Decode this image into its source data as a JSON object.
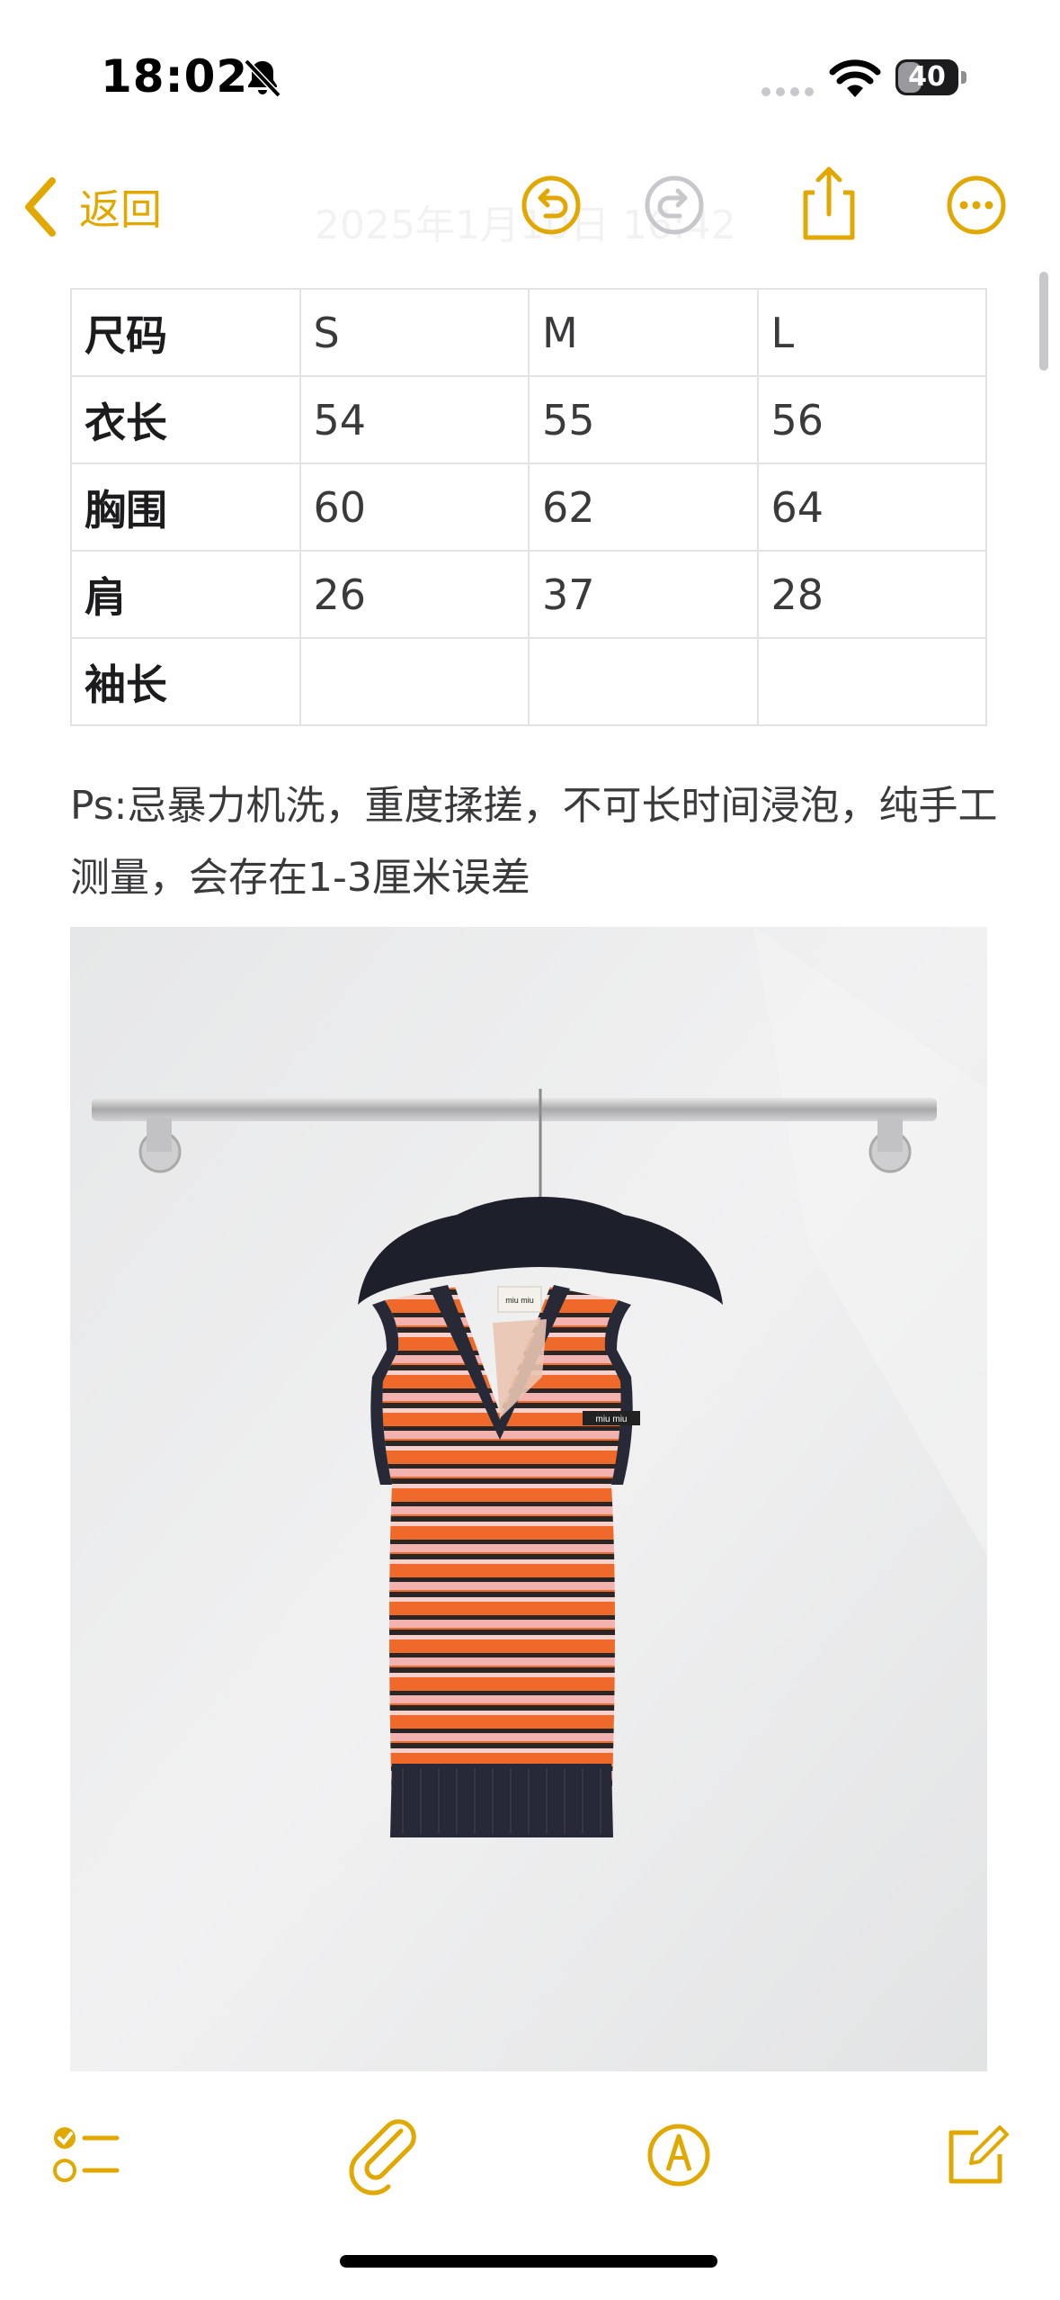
{
  "status": {
    "time": "18:02",
    "battery": "40",
    "battery_level": 0.4
  },
  "nav": {
    "back_label": "返回",
    "ghost_date": "2025年1月10日 16:42"
  },
  "table": {
    "rows": [
      [
        "尺码",
        "S",
        "M",
        "L"
      ],
      [
        "衣长",
        "54",
        "55",
        "56"
      ],
      [
        "胸围",
        "60",
        "62",
        "64"
      ],
      [
        "肩",
        "26",
        "37",
        "28"
      ],
      [
        "袖长",
        "",
        "",
        ""
      ]
    ]
  },
  "note": {
    "text": "Ps:忌暴力机洗，重度揉搓，不可长时间浸泡，纯手工测量，会存在1-3厘米误差"
  },
  "photo": {
    "tag_text": "miu miu",
    "badge_text": "miu miu"
  },
  "icons": {
    "status": [
      "bell-slash-icon",
      "cellular-signal-icon",
      "wifi-icon",
      "battery-icon"
    ],
    "nav": [
      "back-chevron-icon",
      "undo-icon",
      "redo-icon",
      "share-icon",
      "more-icon"
    ],
    "toolbar": [
      "checklist-icon",
      "paperclip-icon",
      "markup-pen-icon",
      "compose-icon"
    ]
  },
  "colors": {
    "accent": "#e0a800",
    "redo_disabled": "#c7c7cc",
    "table_border": "#e3e3e3"
  }
}
